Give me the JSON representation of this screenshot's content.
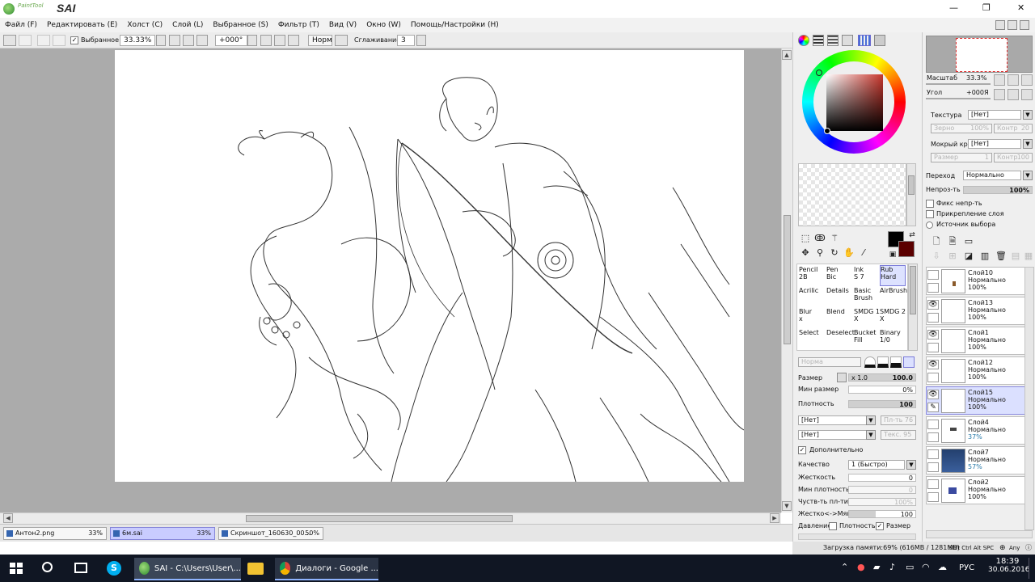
{
  "app": {
    "logo_top": "PaintTool",
    "logo_main": "SAI"
  },
  "window_controls": {
    "minimize": "—",
    "maximize": "❐",
    "close": "✕"
  },
  "menu": [
    "Файл (F)",
    "Редактировать (E)",
    "Холст (C)",
    "Слой (L)",
    "Выбранное (S)",
    "Фильтр (T)",
    "Вид (V)",
    "Окно (W)",
    "Помощь/Настройки (H)"
  ],
  "toolbar": {
    "selection_label": "Выбранное",
    "selection_checked": true,
    "zoom": "33.33%",
    "angle": "+000°",
    "normal": "Норм",
    "smoothing_label": "Сглаживание",
    "smoothing_value": "3"
  },
  "files": [
    {
      "name": "Антон2.png",
      "zoom": "33%",
      "active": false
    },
    {
      "name": "6м.sai",
      "zoom": "33%",
      "active": true
    },
    {
      "name": "Скриншот_160630_00...",
      "zoom": "50%",
      "active": false
    }
  ],
  "navigator": {
    "scale_label": "Масштаб",
    "scale_value": "33.3%",
    "angle_label": "Угол",
    "angle_value": "+000Я"
  },
  "layer_props": {
    "texture_label": "Текстура",
    "texture_value": "[Нет]",
    "grain_label": "Зерно",
    "grain_value": "100%",
    "contrast_label": "Контр",
    "contrast_value": "20",
    "wet_edge_label": "Мокрый край",
    "wet_edge_value": "[Нет]",
    "size_label": "Размер",
    "size_value": "1",
    "contr2_label": "Контр",
    "contr2_value": "100",
    "blend_label": "Переход",
    "blend_value": "Нормально",
    "opacity_label": "Непроз-ть",
    "opacity_value": "100%",
    "opacity_fraction": 1.0,
    "preserve_opacity": "Фикс непр-ть",
    "clip_layer": "Прикрепление слоя",
    "selection_source": "Источник выбора"
  },
  "color_panel": {
    "primary": "#000000",
    "secondary": "#5b0000",
    "square_hue": "#c8362c"
  },
  "tools": [
    {
      "label": "Pencil\n2B",
      "selected": false
    },
    {
      "label": "Pen\nBic",
      "selected": false
    },
    {
      "label": "Ink\nS 7",
      "selected": false
    },
    {
      "label": "Rub\nHard",
      "selected": true
    },
    {
      "label": "Acrilic",
      "selected": false
    },
    {
      "label": "Details",
      "selected": false
    },
    {
      "label": "Basic\nBrush",
      "selected": false
    },
    {
      "label": "AirBrush",
      "selected": false
    },
    {
      "label": "Blur\nx",
      "selected": false
    },
    {
      "label": "Blend",
      "selected": false
    },
    {
      "label": "SMDG 1\nX",
      "selected": false
    },
    {
      "label": "SMDG 2\nX",
      "selected": false
    },
    {
      "label": "Select",
      "selected": false
    },
    {
      "label": "Deselect",
      "selected": false
    },
    {
      "label": "Bucket\nFill",
      "selected": false
    },
    {
      "label": "Binary\n1/0",
      "selected": false
    }
  ],
  "brush": {
    "mode": "Норма",
    "size_label": "Размер",
    "size_mult": "x 1.0",
    "size_value": "100.0",
    "min_size_label": "Мин размер",
    "min_size_value": "0%",
    "density_label": "Плотность",
    "density_value": "100",
    "density_fraction": 1.0,
    "tex1": "[Нет]",
    "tex1_right": "Пл-ть 76",
    "tex2": "[Нет]",
    "tex2_right": "Текс. 95",
    "advanced_label": "Дополнительно",
    "advanced_checked": true,
    "quality_label": "Качество",
    "quality_value": "1 (Быстро)",
    "hardness_label": "Жесткость",
    "hardness_value": "0",
    "min_density_label": "Мин плотность",
    "min_density_value": "0",
    "sensitivity_label": "Чуств-ть пл-ти",
    "sensitivity_value": "100%",
    "hard_soft_label": "Жестко<->Мягко",
    "hard_soft_value": "100",
    "pressure_label": "Давление:",
    "pressure_density": "Плотность",
    "pressure_size": "Размер",
    "pressure_size_checked": true
  },
  "layers": [
    {
      "name": "Слой10",
      "mode": "Нормально",
      "opacity": "100%",
      "visible": false,
      "selected": false
    },
    {
      "name": "Слой13",
      "mode": "Нормально",
      "opacity": "100%",
      "visible": true,
      "selected": false
    },
    {
      "name": "Слой1",
      "mode": "Нормально",
      "opacity": "100%",
      "visible": true,
      "selected": false
    },
    {
      "name": "Слой12",
      "mode": "Нормально",
      "opacity": "100%",
      "visible": true,
      "selected": false
    },
    {
      "name": "Слой15",
      "mode": "Нормально",
      "opacity": "100%",
      "visible": true,
      "selected": true
    },
    {
      "name": "Слой4",
      "mode": "Нормально",
      "opacity": "37%",
      "visible": false,
      "selected": false
    },
    {
      "name": "Слой7",
      "mode": "Нормально",
      "opacity": "57%",
      "visible": false,
      "selected": false
    },
    {
      "name": "Слой2",
      "mode": "Нормально",
      "opacity": "100%",
      "visible": false,
      "selected": false
    }
  ],
  "status": {
    "memory": "Загрузка памяти:69% (616MB / 1281MB)",
    "keys": "Shft Ctrl Alt SPC",
    "any": "Any"
  },
  "taskbar": {
    "app1": "SAI - C:\\Users\\User\\...",
    "app2": "Диалоги - Google ...",
    "lang": "РУС",
    "time": "18:39",
    "date": "30.06.2016"
  }
}
